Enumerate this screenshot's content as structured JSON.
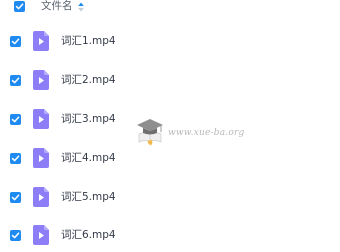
{
  "header": {
    "column_name": "文件名",
    "select_all_checked": true,
    "sort_icon": "sort-arrow-up-icon"
  },
  "files": [
    {
      "name": "词汇1.mp4",
      "checked": true,
      "icon": "video-file-icon"
    },
    {
      "name": "词汇2.mp4",
      "checked": true,
      "icon": "video-file-icon"
    },
    {
      "name": "词汇3.mp4",
      "checked": true,
      "icon": "video-file-icon"
    },
    {
      "name": "词汇4.mp4",
      "checked": true,
      "icon": "video-file-icon"
    },
    {
      "name": "词汇5.mp4",
      "checked": true,
      "icon": "video-file-icon"
    },
    {
      "name": "词汇6.mp4",
      "checked": true,
      "icon": "video-file-icon"
    }
  ],
  "watermark": {
    "text": "www.xue-ba.org"
  },
  "colors": {
    "checkbox": "#1f8bf0",
    "video_icon": "#8d7ef7",
    "text": "#343a48",
    "header_text": "#5a6270"
  }
}
